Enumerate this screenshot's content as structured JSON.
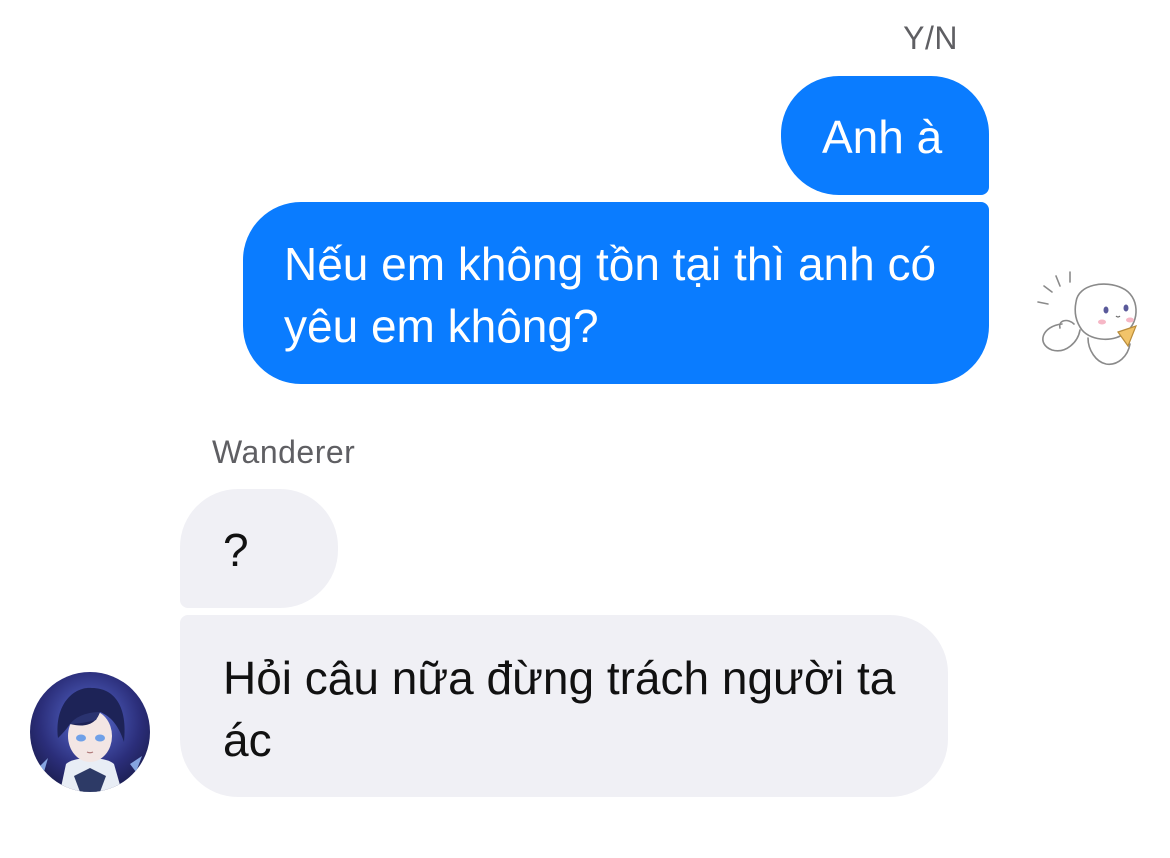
{
  "conversation": {
    "me_name": "Y/N",
    "other_name": "Wanderer",
    "messages": [
      {
        "from": "me",
        "text": "Anh à"
      },
      {
        "from": "me",
        "text": "Nếu em không tồn tại thì anh có yêu em không?"
      },
      {
        "from": "other",
        "text": "?"
      },
      {
        "from": "other",
        "text": "Hỏi câu nữa đừng trách người ta ác"
      }
    ]
  },
  "colors": {
    "outgoing_bubble": "#0a7cff",
    "incoming_bubble": "#f0f0f5",
    "name_text": "#5f5f63"
  },
  "icons": {
    "reaction_sticker": "cinnamoroll-sticker-icon",
    "avatar": "wanderer-avatar"
  }
}
